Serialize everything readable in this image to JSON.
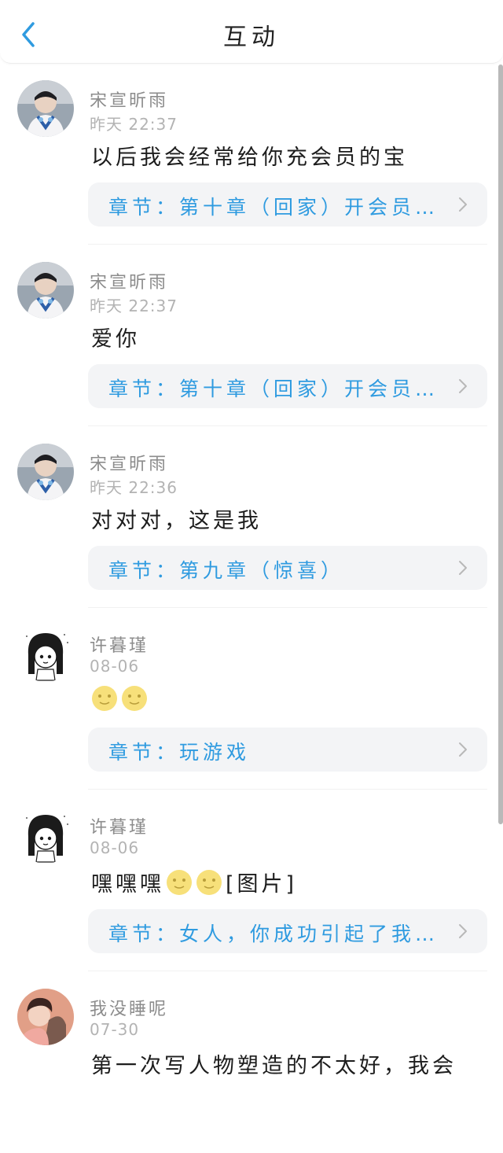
{
  "header": {
    "title": "互动",
    "back_icon": "chevron-left-icon",
    "accent": "#2f9be0"
  },
  "items": [
    {
      "user": "宋宣昕雨",
      "time": "昨天 22:37",
      "content": "以后我会经常给你充会员的宝",
      "chapter": "章节：第十章（回家）开会员…"
    },
    {
      "user": "宋宣昕雨",
      "time": "昨天 22:37",
      "content": "爱你",
      "chapter": "章节：第十章（回家）开会员…"
    },
    {
      "user": "宋宣昕雨",
      "time": "昨天 22:36",
      "content": "对对对，这是我",
      "chapter": "章节：第九章（惊喜）"
    },
    {
      "user": "许暮瑾",
      "time": "08-06",
      "content": "",
      "emoji_count": 2,
      "chapter": "章节：玩游戏"
    },
    {
      "user": "许暮瑾",
      "time": "08-06",
      "content_prefix": "嘿嘿嘿",
      "content_suffix": "[图片]",
      "emoji_count": 2,
      "chapter": "章节：女人，你成功引起了我…"
    },
    {
      "user": "我没睡呢",
      "time": "07-30",
      "content": "第一次写人物塑造的不太好，我会"
    }
  ]
}
